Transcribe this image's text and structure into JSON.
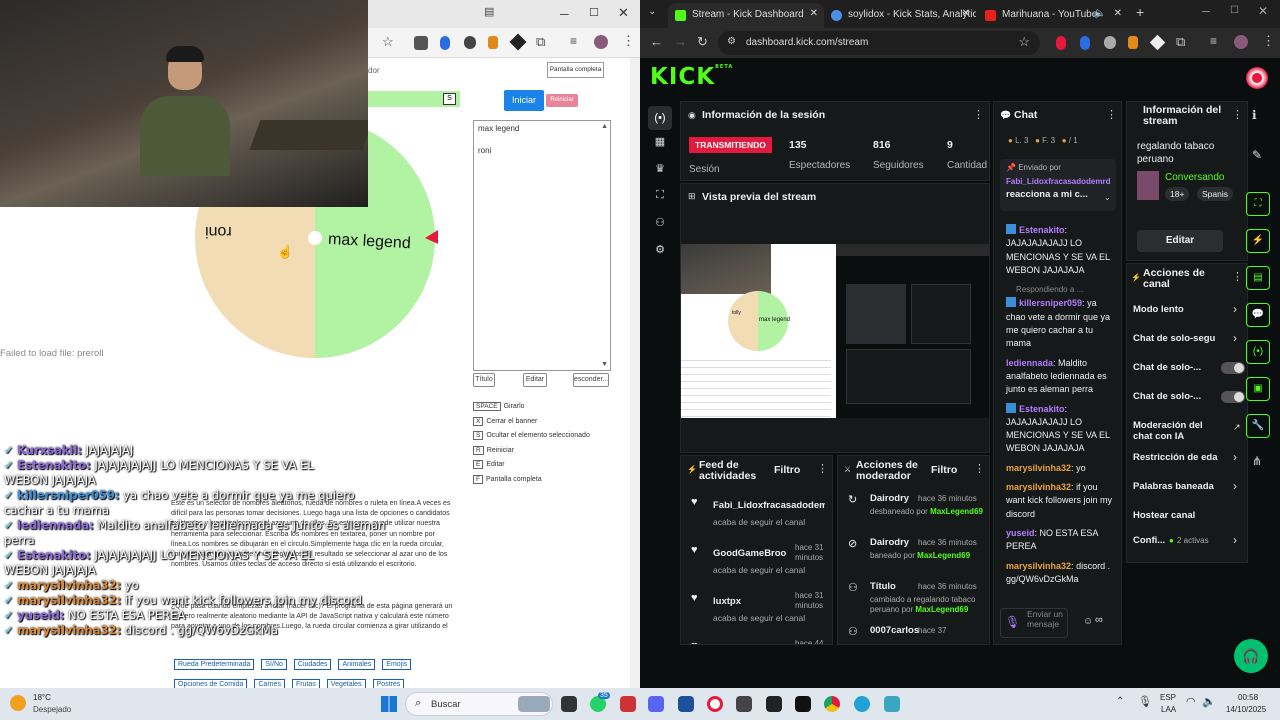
{
  "left": {
    "fullscreen_small": "Pantalla completa",
    "partial_url_fragment": "dor",
    "start_button": "Iniciar",
    "reset_button": "Reiniciar",
    "names": [
      "max legend",
      "",
      "roni"
    ],
    "wheel_label_1": "max legend",
    "wheel_label_2": "roni",
    "title_btn": "Título",
    "edit_btn": "Editar",
    "hide_btn": "esconder...",
    "shortcuts": [
      {
        "key": "SPACE",
        "label": "Girarlo"
      },
      {
        "key": "X",
        "label": "Cerrar el banner"
      },
      {
        "key": "S",
        "label": "Ocultar el elemento seleccionado"
      },
      {
        "key": "R",
        "label": "Reiniciar"
      },
      {
        "key": "E",
        "label": "Editar"
      },
      {
        "key": "F",
        "label": "Pantalla completa"
      }
    ],
    "preroll_error": "Failed to load file: preroll",
    "desc_1": "Este es un selector de nombres aleatorios, rueda de nombres o ruleta en línea.A veces es difícil para las personas tomar decisiones. Luego haga una lista de opciones o candidatos existentes y luego seleccione al azar uno de ellos. En este caso, puede utilizar nuestra herramienta para seleccionar. Escriba los nombres en textarea, poner un nombre por línea.Los nombres se dibujarán en el círculo.Simplemente haga clic en la rueda circular, comenzará a girar durante unos segundos. El resultado se seleccionar al azar uno de los nombres. Usamos útiles teclas de acceso directo si está utilizando el escritorio.",
    "desc_2": "¿Qué pasa cuando empiezas a rotar (hacer clic)? El programa de esta página generará un número realmente aleatorio mediante la API de JavaScript nativa y calculará este número para apuntar a uno de los nombres.Luego, la rueda circular comienza a girar utilizando el",
    "presets": [
      "Rueda Predeterminada",
      "Sí/No",
      "Ciudades",
      "Animales",
      "Emojis",
      "Opciones de Comida",
      "Carnes",
      "Frutas",
      "Vegetales",
      "Postres"
    ],
    "overlay_chat": [
      {
        "name": "Kurxsakil:",
        "msg": " JAJAJAJAJ",
        "color": "#8e6ad9"
      },
      {
        "name": "Estenakito:",
        "msg": " JAJAJAJAJAJJ LO MENCIONAS Y SE VA EL",
        "color": "#8e6ad9"
      },
      {
        "name": "",
        "msg": "WEBON JAJAJAJA",
        "color": "#fff"
      },
      {
        "name": "killersniper059:",
        "msg": " ya chao vete a dormir que ya me quiero",
        "color": "#3a8fd8"
      },
      {
        "name": "",
        "msg": "cachar a tu mama",
        "color": "#fff"
      },
      {
        "name": "lediennada:",
        "msg": " Maldito analfabeto lediennada es junto es aleman",
        "color": "#8e6ad9"
      },
      {
        "name": "",
        "msg": "perra",
        "color": "#fff"
      },
      {
        "name": "Estenakito:",
        "msg": " JAJAJAJAJAJJ LO MENCIONAS Y SE VA EL",
        "color": "#8e6ad9"
      },
      {
        "name": "",
        "msg": "WEBON JAJAJAJA",
        "color": "#fff"
      },
      {
        "name": "marysilvinha32:",
        "msg": " yo",
        "color": "#d88a3a"
      },
      {
        "name": "marysilvinha32:",
        "msg": " if you want kick followers join my discord",
        "color": "#d88a3a"
      },
      {
        "name": "yuseid:",
        "msg": " NO ESTA ESA PEREA",
        "color": "#8e6ad9"
      },
      {
        "name": "marysilvinha32:",
        "msg": " discord . gg/QW6vDzGkMa",
        "color": "#d88a3a"
      }
    ]
  },
  "browser": {
    "tabs": [
      "Stream - Kick Dashboard",
      "soylidox - Kick Stats, Analytics",
      "Marihuana - YouTube"
    ],
    "url": "dashboard.kick.com/stream"
  },
  "kick": {
    "logo": "KICK",
    "beta": "BETA",
    "session": {
      "title": "Información de la sesión",
      "status": "TRANSMITIENDO",
      "status_label": "Sesión",
      "stats": [
        {
          "value": "135",
          "label": "Espectadores"
        },
        {
          "value": "816",
          "label": "Seguidores"
        },
        {
          "value": "9",
          "label": "Cantidad de suscripciones"
        }
      ]
    },
    "preview_title": "Vista previa del stream",
    "preview_wheel_name": "max legend",
    "preview_wheel_name2": "tolly",
    "chat": {
      "title": "Chat",
      "levels": [
        "L. 3",
        "F. 3",
        "/ 1"
      ],
      "pinned_by": "Enviado por",
      "pinned_user": "Fabi_Lidoxfracasadodemrd",
      "pinned_msg": "reacciona a mi c...",
      "messages": [
        {
          "name": "Estenakito",
          "text": "JAJAJAJAJAJJ LO MENCIONAS Y SE VA EL WEBON JAJAJAJA",
          "color": "#b37cff",
          "badge": true
        },
        {
          "reply": "Respondiendo a ..."
        },
        {
          "name": "killersniper059",
          "text": "ya chao vete a dormir que ya me quiero cachar a tu mama",
          "color": "#b37cff",
          "badge": true
        },
        {
          "name": "lediennada",
          "text": "Maldito analfabeto lediennada es junto es aleman perra",
          "color": "#b37cff",
          "badge": false
        },
        {
          "name": "Estenakito",
          "text": "JAJAJAJAJAJJ LO MENCIONAS Y SE VA EL WEBON JAJAJAJA",
          "color": "#b37cff",
          "badge": true
        },
        {
          "name": "marysilvinha32",
          "text": "yo",
          "color": "#e8a33a",
          "badge": false
        },
        {
          "name": "marysilvinha32",
          "text": "if you want kick followers join my discord",
          "color": "#e8a33a",
          "badge": false
        },
        {
          "name": "yuseid",
          "text": "NO ESTA ESA PEREA",
          "color": "#b37cff",
          "badge": false
        },
        {
          "name": "marysilvinha32",
          "text": "discord . gg/QW6vDzGkMa",
          "color": "#e8a33a",
          "badge": false
        }
      ],
      "input_placeholder": "Enviar un mensaje"
    },
    "stream_info": {
      "title": "Información del stream",
      "stream_title": "regalando tabaco peruano",
      "category": "Conversando",
      "tags": [
        "18+",
        "Spanis"
      ],
      "edit": "Editar"
    },
    "channel_actions": {
      "title": "Acciones de canal",
      "items": [
        "Modo lento",
        "Chat de solo-segu",
        "Chat de solo-...",
        "Chat de solo-...",
        "Moderación del chat con IA",
        "Restricción de eda",
        "Palabras baneada",
        "Hostear canal",
        "Confi..."
      ],
      "active_label": "2 activas"
    },
    "activity": {
      "title": "Feed de actividades",
      "filter": "Filtro",
      "items": [
        {
          "user": "Fabi_Lidoxfracasadodem",
          "time": "",
          "action": "acaba de seguir el canal"
        },
        {
          "user": "GoodGameBroo",
          "time": "hace 31 minutos",
          "action": "acaba de seguir el canal"
        },
        {
          "user": "luxtpx",
          "time": "hace 31 minutos",
          "action": "acaba de seguir el canal"
        },
        {
          "user": "goodnightp",
          "time": "hace 44",
          "action": ""
        }
      ]
    },
    "mod_actions": {
      "title": "Acciones de moderador",
      "filter": "Filtro",
      "items": [
        {
          "user": "Dairodry",
          "time": "hace 36 minutos",
          "line2": "desbaneado por",
          "mod": "MaxLegend69"
        },
        {
          "user": "Dairodry",
          "time": "hace 36 minutos",
          "line2": "baneado por",
          "mod": "MaxLegend69"
        },
        {
          "user": "Título",
          "time": "hace 36 minutos",
          "line2": "cambiado a regalando tabaco peruano por",
          "mod": "MaxLegend69"
        },
        {
          "user": "0007carlos",
          "time": "hace 37",
          "line2": "",
          "mod": ""
        }
      ]
    }
  },
  "taskbar": {
    "weather_temp": "18°C",
    "weather_desc": "Despejado",
    "search": "Buscar",
    "badge": "35",
    "lang": "ESP",
    "lang2": "LAA",
    "time": "00:58",
    "date": "14/10/2025"
  },
  "colors": {
    "kick_green": "#53fc18",
    "live_red": "#e5193d",
    "wheel_green": "#b2f2a3",
    "wheel_beige": "#f2dcb3"
  }
}
